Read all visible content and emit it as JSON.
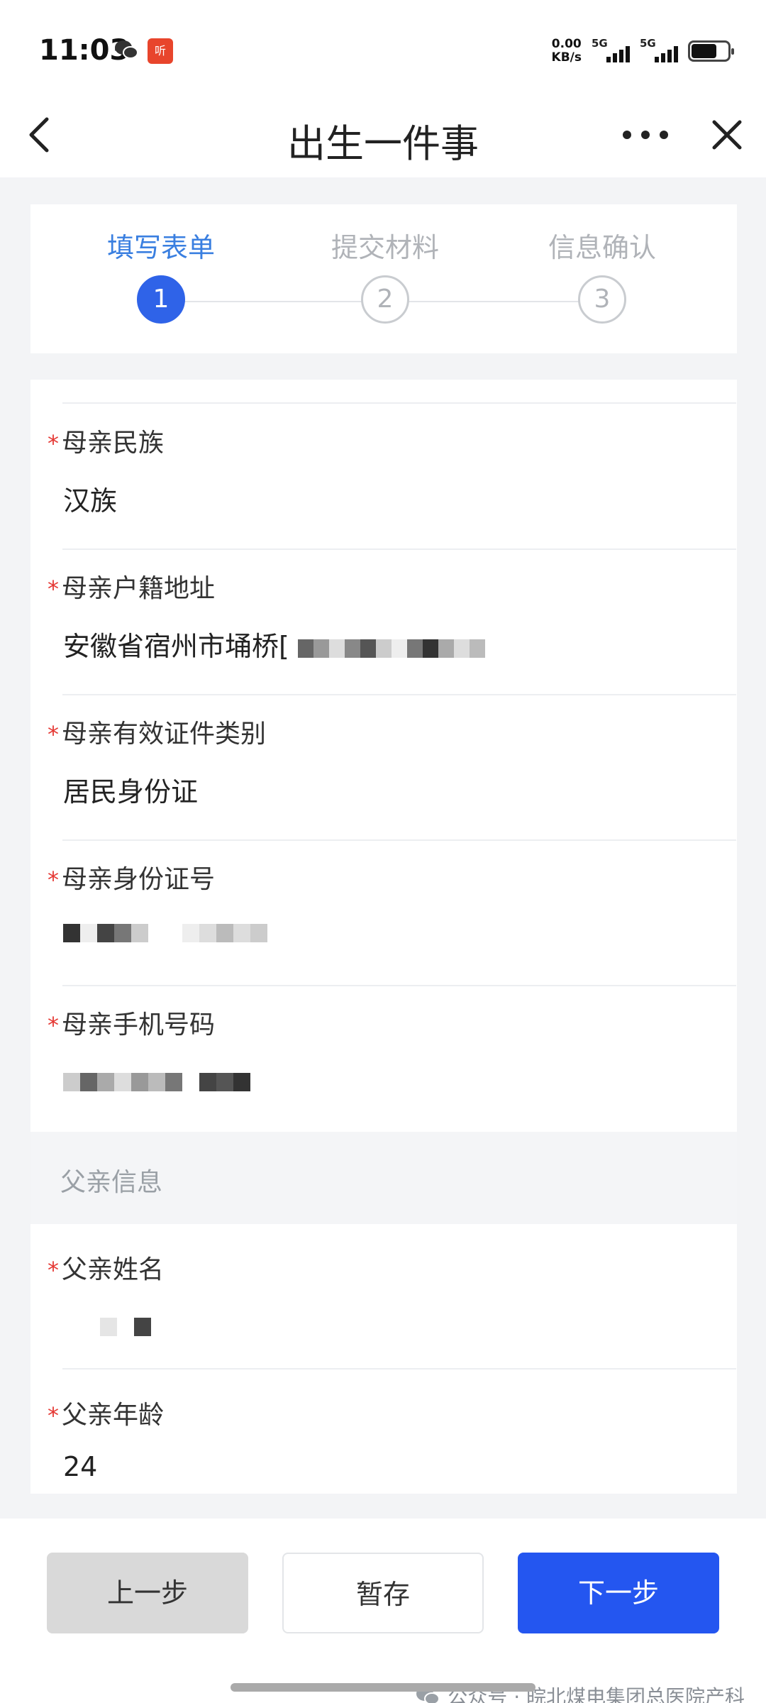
{
  "status_bar": {
    "time": "11:03",
    "net_speed_value": "0.00",
    "net_speed_unit": "KB/s",
    "signal1": "5G",
    "signal2": "5G",
    "app_badge": "听"
  },
  "nav": {
    "title": "出生一件事"
  },
  "steps": [
    {
      "label": "填写表单",
      "number": "1",
      "active": true
    },
    {
      "label": "提交材料",
      "number": "2",
      "active": false
    },
    {
      "label": "信息确认",
      "number": "3",
      "active": false
    }
  ],
  "form": {
    "required_mark": "*",
    "mother_ethnicity": {
      "label": "母亲民族",
      "value": "汉族"
    },
    "mother_address": {
      "label": "母亲户籍地址",
      "value": "安徽省宿州市埇桥["
    },
    "mother_id_type": {
      "label": "母亲有效证件类别",
      "value": "居民身份证"
    },
    "mother_id_number": {
      "label": "母亲身份证号",
      "value": ""
    },
    "mother_phone": {
      "label": "母亲手机号码",
      "value": ""
    },
    "father_section": "父亲信息",
    "father_name": {
      "label": "父亲姓名",
      "value": ""
    },
    "father_age": {
      "label": "父亲年龄",
      "value": "24"
    }
  },
  "buttons": {
    "prev": "上一步",
    "save": "暂存",
    "next": "下一步"
  },
  "watermark": "公众号 · 皖北煤电集团总医院产科",
  "colors": {
    "accent": "#2456f0",
    "active_step": "#3a7fe0",
    "required": "#e53935"
  }
}
